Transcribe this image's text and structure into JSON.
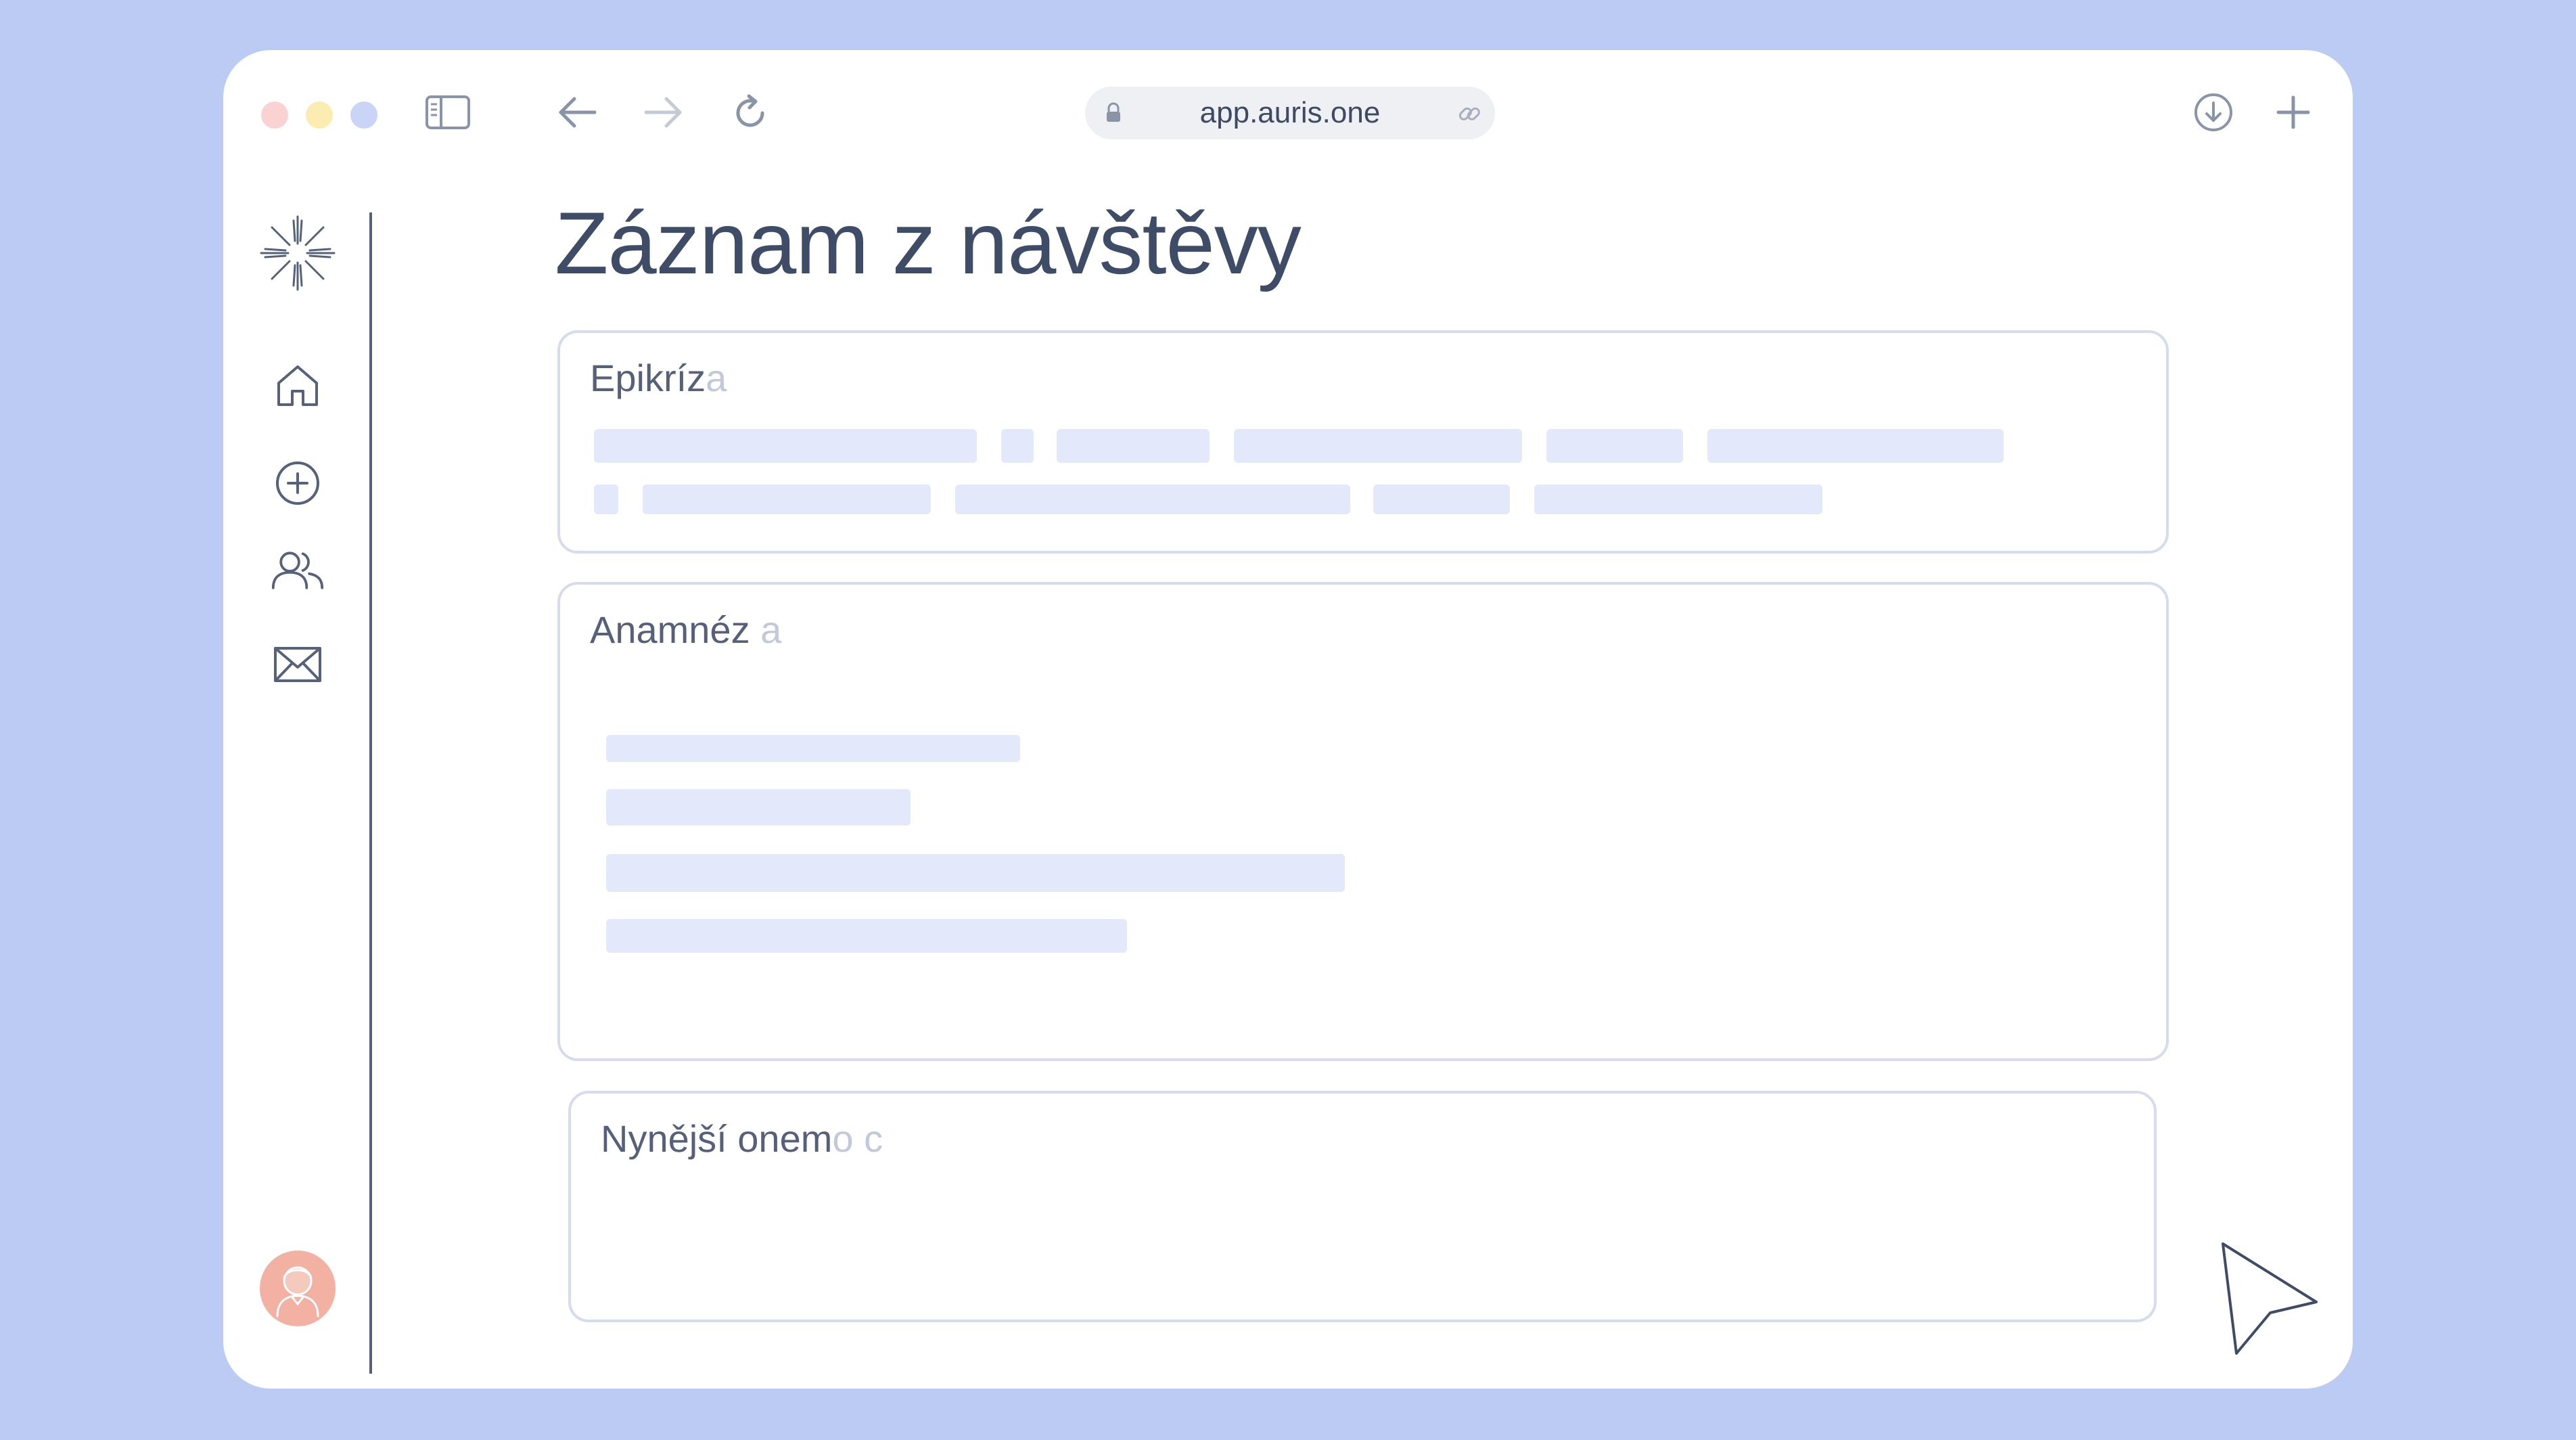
{
  "browser": {
    "url": "app.auris.one",
    "traffic_lights": [
      "#fbd2d2",
      "#fbecb2",
      "#c9d4f6"
    ]
  },
  "page": {
    "title": "Záznam z návštěvy"
  },
  "sections": [
    {
      "title": "Epikríz",
      "title_fade": "a"
    },
    {
      "title": "Anamnéz",
      "title_fade": " a"
    },
    {
      "title": "Nynější onem",
      "title_fade": "o c"
    }
  ],
  "sidebar": {
    "items": [
      "logo-icon",
      "home-icon",
      "add-icon",
      "users-icon",
      "mail-icon"
    ],
    "avatar": "avatar"
  },
  "colors": {
    "background": "#bccbf3",
    "window": "#ffffff",
    "text": "#3f4c68",
    "skeleton": "#e3e9fb",
    "card_border": "#d5dcee",
    "avatar": "#f3b1a3"
  }
}
